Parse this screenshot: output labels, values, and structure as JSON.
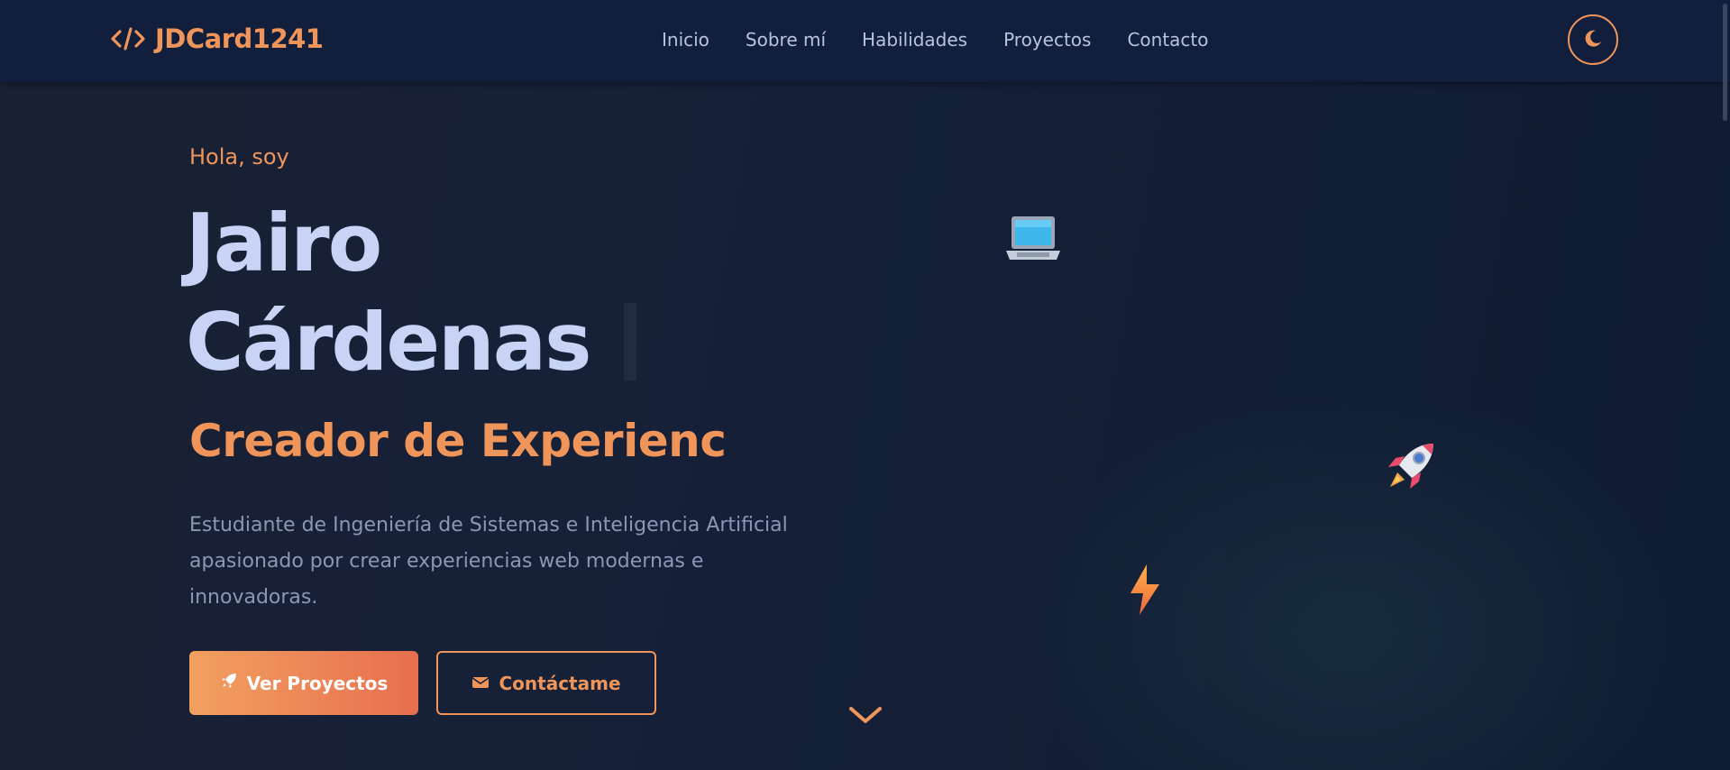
{
  "navbar": {
    "brand": {
      "icon": "code-icon",
      "text": "JDCard1241"
    },
    "links": [
      {
        "label": "Inicio"
      },
      {
        "label": "Sobre mí"
      },
      {
        "label": "Habilidades"
      },
      {
        "label": "Proyectos"
      },
      {
        "label": "Contacto"
      }
    ],
    "theme_toggle": {
      "icon": "moon-icon"
    }
  },
  "hero": {
    "greeting": "Hola, soy",
    "name_line1": "Jairo",
    "name_line2": "Cárdenas",
    "typed_text": "Creador de Experienc",
    "description": "Estudiante de Ingeniería de Sistemas e Inteligencia Artificial apasionado por crear experiencias web modernas e innovadoras.",
    "buttons": {
      "primary": {
        "label": "Ver Proyectos",
        "icon": "rocket-icon"
      },
      "secondary": {
        "label": "Contáctame",
        "icon": "envelope-icon"
      }
    },
    "scroll_icon": "chevron-down-icon",
    "floating_icons": [
      "laptop-icon",
      "rocket-icon",
      "lightning-icon"
    ]
  },
  "colors": {
    "accent": "#f0955a",
    "name_text": "#c8d3f5",
    "nav_bg": "#111f3c",
    "body_text": "#8d97b5"
  }
}
